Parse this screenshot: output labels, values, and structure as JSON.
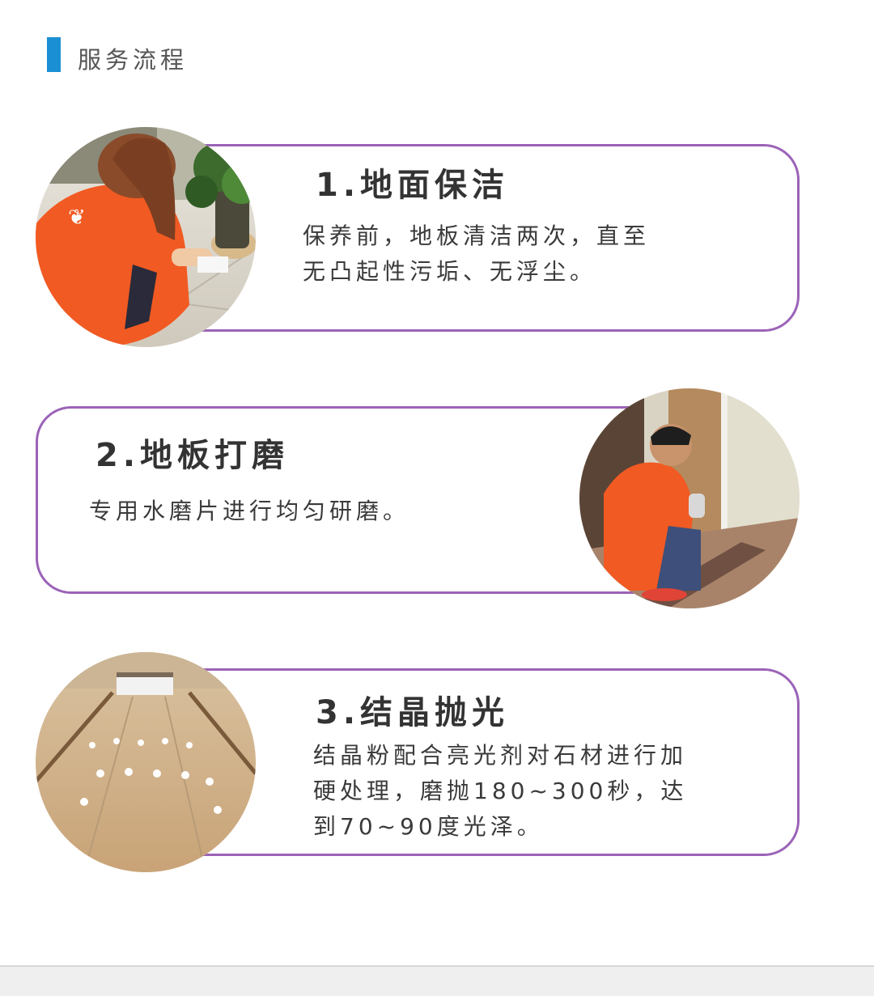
{
  "header": {
    "title": "服务流程",
    "accent_color": "#1b8fd3"
  },
  "border_color": "#9b63b7",
  "steps": [
    {
      "title": "1.地面保洁",
      "lines": [
        "保养前，地板清洁两次，直至",
        "无凸起性污垢、无浮尘。"
      ],
      "photo": "worker-wiping-floor-photo"
    },
    {
      "title": "2.地板打磨",
      "lines": [
        "专用水磨片进行均匀研磨。"
      ],
      "photo": "worker-grinding-floor-photo"
    },
    {
      "title": "3.结晶抛光",
      "lines": [
        "结晶粉配合亮光剂对石材进行加",
        "硬处理，磨抛180~300秒，达",
        "到70~90度光泽。"
      ],
      "photo": "polished-marble-floor-photo"
    }
  ]
}
